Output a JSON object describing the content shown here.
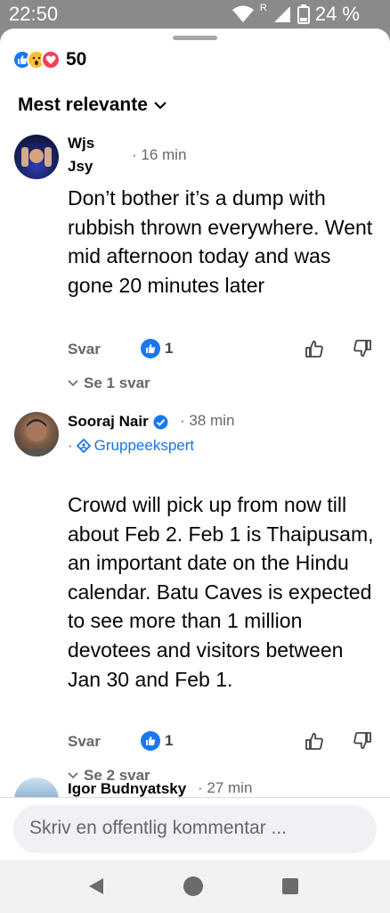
{
  "status_bar": {
    "time": "22:50",
    "network_label": "R",
    "battery": "24 %"
  },
  "reactions": {
    "icons": [
      "like-icon",
      "wow-icon",
      "love-icon"
    ],
    "count": "50"
  },
  "sort": {
    "label": "Mest relevante"
  },
  "comments": [
    {
      "author_line1": "Wjs",
      "author_line2": "Jsy",
      "time": "· 16 min",
      "body": "Don’t bother it’s a dump with rubbish thrown everywhere. Went mid afternoon today and was gone 20 minutes later",
      "reply_label": "Svar",
      "like_count": "1",
      "replies_label": "Se 1 svar"
    },
    {
      "author": "Sooraj Nair",
      "verified": true,
      "time": "· 38 min",
      "badge_prefix": "·",
      "badge": "Gruppeekspert",
      "body": "Crowd will pick up from now till about Feb 2. Feb 1 is Thaipusam, an important date on the Hindu calendar. Batu Caves is expected to see more than  1 million devotees and visitors  between Jan 30 and Feb 1.",
      "reply_label": "Svar",
      "like_count": "1",
      "replies_label": "Se 2 svar"
    },
    {
      "author": "Igor Budnyatsky",
      "time": "· 27 min"
    }
  ],
  "composer": {
    "placeholder": "Skriv en offentlig kommentar ..."
  },
  "colors": {
    "accent": "#1877f2",
    "secondary_text": "#65676b",
    "love": "#f33e58",
    "wow": "#f7c034"
  }
}
